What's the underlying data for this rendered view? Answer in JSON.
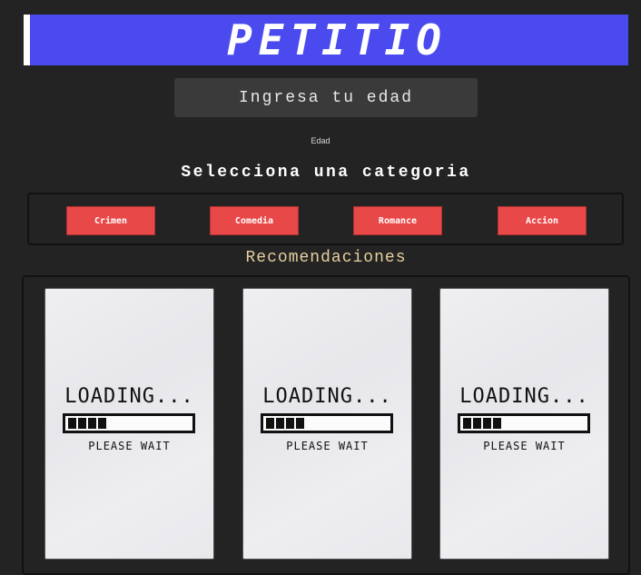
{
  "header": {
    "title": "PETITIO",
    "accent_color": "#4a4aef"
  },
  "age": {
    "placeholder": "Ingresa tu edad",
    "label": "Edad"
  },
  "categories": {
    "title": "Selecciona una categoria",
    "button_color": "#e84848",
    "items": [
      {
        "label": "Crimen"
      },
      {
        "label": "Comedia"
      },
      {
        "label": "Romance"
      },
      {
        "label": "Accion"
      }
    ]
  },
  "recommendations": {
    "title": "Recomendaciones",
    "cards": [
      {
        "loading_text": "LOADING...",
        "wait_text": "PLEASE WAIT",
        "progress": 0.3
      },
      {
        "loading_text": "LOADING...",
        "wait_text": "PLEASE WAIT",
        "progress": 0.3
      },
      {
        "loading_text": "LOADING...",
        "wait_text": "PLEASE WAIT",
        "progress": 0.3
      }
    ]
  }
}
